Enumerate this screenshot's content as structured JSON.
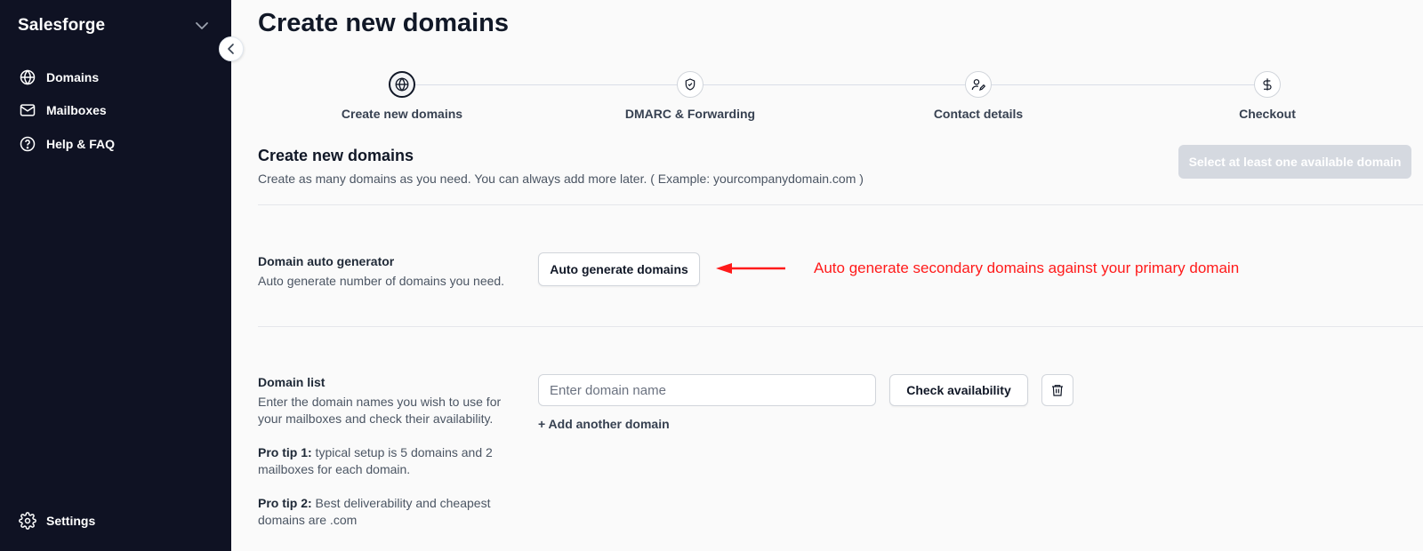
{
  "sidebar": {
    "brand": "Salesforge",
    "items": [
      {
        "label": "Domains",
        "icon": "globe-icon"
      },
      {
        "label": "Mailboxes",
        "icon": "mail-icon"
      },
      {
        "label": "Help & FAQ",
        "icon": "help-circle-icon"
      }
    ],
    "settings_label": "Settings"
  },
  "page": {
    "title": "Create new domains"
  },
  "stepper": {
    "steps": [
      {
        "label": "Create new domains",
        "icon": "globe-icon",
        "active": true
      },
      {
        "label": "DMARC & Forwarding",
        "icon": "shield-check-icon",
        "active": false
      },
      {
        "label": "Contact details",
        "icon": "user-edit-icon",
        "active": false
      },
      {
        "label": "Checkout",
        "icon": "dollar-icon",
        "active": false
      }
    ]
  },
  "create_section": {
    "title": "Create new domains",
    "description": "Create as many domains as you need. You can always add more later. ( Example: yourcompanydomain.com )",
    "select_button": "Select at least one available domain"
  },
  "auto_generator": {
    "title": "Domain auto generator",
    "description": "Auto generate number of domains you need.",
    "button": "Auto generate domains",
    "annotation": "Auto generate secondary domains against your primary domain"
  },
  "domain_list": {
    "title": "Domain list",
    "description_line1": "Enter the domain names you wish to use for",
    "description_line2": "your mailboxes and check their availability.",
    "protip1_label": "Pro tip 1:",
    "protip1_line1": " typical setup is 5 domains and 2",
    "protip1_line2": "mailboxes for each domain.",
    "protip2_label": "Pro tip 2:",
    "protip2_line1": " Best deliverability and cheapest",
    "protip2_line2": "domains are .com",
    "input_placeholder": "Enter domain name",
    "input_value": "",
    "check_button": "Check availability",
    "add_link": "+ Add another domain"
  },
  "colors": {
    "sidebar_bg": "#0f1223",
    "annotation": "#ff1a1a",
    "disabled_button": "#d5d9e0"
  }
}
